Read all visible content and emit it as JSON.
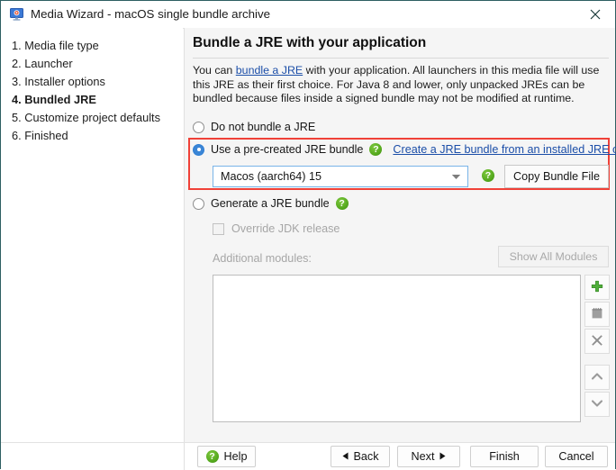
{
  "window": {
    "title": "Media Wizard - macOS single bundle archive",
    "icon": "monitor-icon",
    "close_icon": "close-icon",
    "border_color": "#2d5f62"
  },
  "sidebar": {
    "items": [
      {
        "label": "1. Media file type",
        "current": false
      },
      {
        "label": "2. Launcher",
        "current": false
      },
      {
        "label": "3. Installer options",
        "current": false
      },
      {
        "label": "4. Bundled JRE",
        "current": true
      },
      {
        "label": "5. Customize project defaults",
        "current": false
      },
      {
        "label": "6. Finished",
        "current": false
      }
    ]
  },
  "panel": {
    "heading": "Bundle a JRE with your application",
    "description": {
      "pre": "You can ",
      "link": "bundle a JRE",
      "post": " with your application. All launchers in this media file will use this JRE as their first choice. For Java 8 and lower, only unpacked JREs can be bundled because files inside a signed bundle may not be modified at runtime."
    },
    "options": {
      "do_not_bundle": "Do not bundle a JRE",
      "use_precreated": "Use a pre-created JRE bundle",
      "generate": "Generate a JRE bundle"
    },
    "create_bundle_link": "Create a JRE bundle from an installed JRE or JDK",
    "combo": {
      "value": "Macos (aarch64) 15",
      "arrow_icon": "chevron-down-icon"
    },
    "copy_bundle_label": "Copy Bundle File",
    "override_jdk_label": "Override JDK release",
    "additional_modules_label": "Additional modules:",
    "show_all_modules_label": "Show All Modules",
    "help_icon": "help-icon",
    "tool_buttons": [
      {
        "name": "add-module-button",
        "icon": "plus-icon"
      },
      {
        "name": "edit-module-button",
        "icon": "notepad-icon"
      },
      {
        "name": "remove-module-button",
        "icon": "cross-icon"
      },
      {
        "name": "move-up-button",
        "icon": "chevron-up-icon"
      },
      {
        "name": "move-down-button",
        "icon": "chevron-down-icon"
      }
    ],
    "highlight_color": "#f04138"
  },
  "footer": {
    "help": "Help",
    "back": "Back",
    "next": "Next",
    "finish": "Finish",
    "cancel": "Cancel",
    "back_icon": "triangle-left-icon",
    "next_icon": "triangle-right-icon"
  }
}
